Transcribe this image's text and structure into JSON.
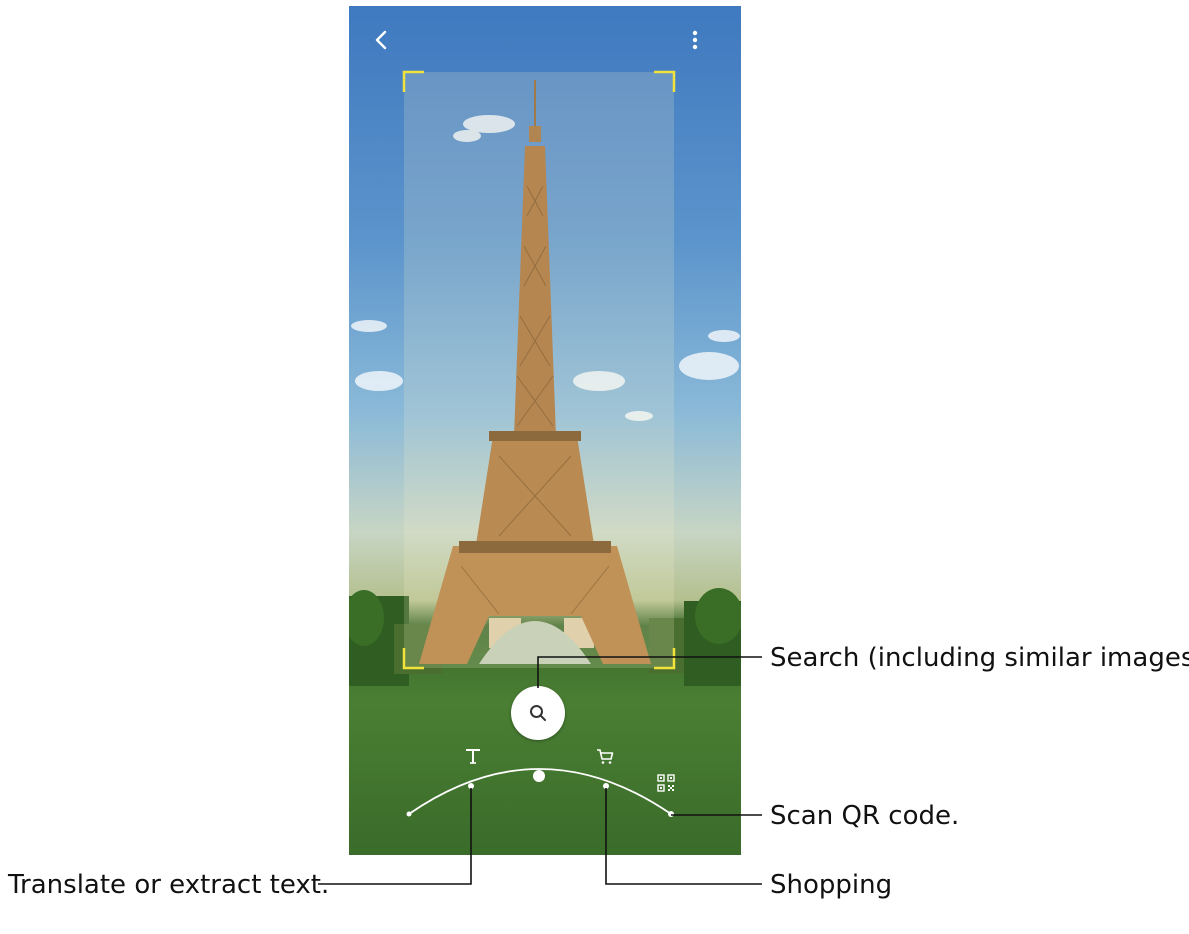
{
  "screen": {
    "controls": {
      "back_icon": "chevron-left-icon",
      "more_icon": "more-vertical-icon",
      "search_icon": "magnifier-icon",
      "text_icon": "text-T-icon",
      "shopping_icon": "shopping-cart-icon",
      "qr_icon": "qr-code-icon"
    },
    "colors": {
      "focus_bracket": "#f2e33a",
      "control_white": "#ffffff",
      "leader_line": "#111111"
    }
  },
  "callouts": {
    "search": "Search (including similar images)",
    "qr": "Scan QR code.",
    "shopping": "Shopping",
    "text": "Translate or extract text."
  }
}
